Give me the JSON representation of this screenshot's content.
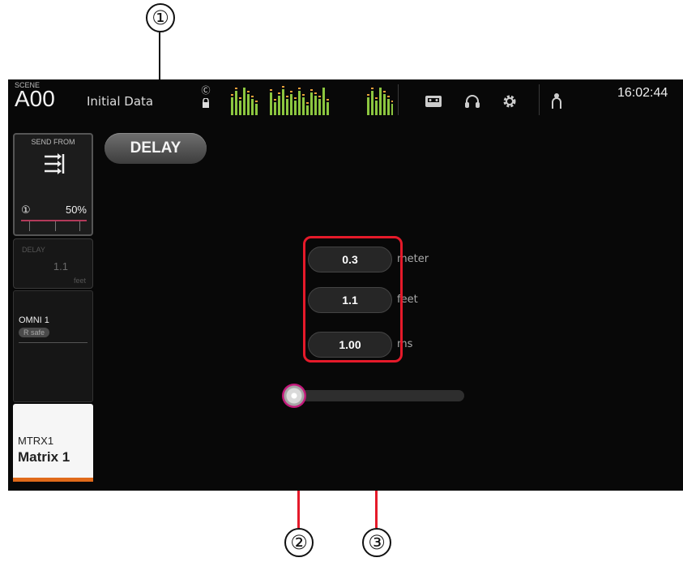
{
  "callouts": [
    "①",
    "②",
    "③"
  ],
  "header": {
    "scene_label": "SCENE",
    "scene_number": "A00",
    "scene_name": "Initial Data",
    "time": "16:02:44"
  },
  "strip": {
    "send_from_title": "SEND FROM",
    "send_level": "50%",
    "delay_label": "DELAY",
    "delay_value": "1.1",
    "delay_unit": "feet",
    "port_name": "OMNI 1",
    "port_badge": "R safe",
    "channel_id": "MTRX1",
    "channel_name": "Matrix 1"
  },
  "delay_button": "DELAY",
  "delay_values": [
    {
      "value": "0.3",
      "unit": "meter"
    },
    {
      "value": "1.1",
      "unit": "feet"
    },
    {
      "value": "1.00",
      "unit": "ms"
    }
  ],
  "slider": {
    "level": 0.0
  },
  "colors": {
    "highlight": "#e51a2a",
    "accent_orange": "#e06a1a",
    "knob_ring": "#c2187a",
    "meter_green": "#8cc63f"
  },
  "icons": [
    "recorder-icon",
    "headphones-icon",
    "setup-gear-icon",
    "user-icon",
    "send-from-icon",
    "lock-icon"
  ]
}
